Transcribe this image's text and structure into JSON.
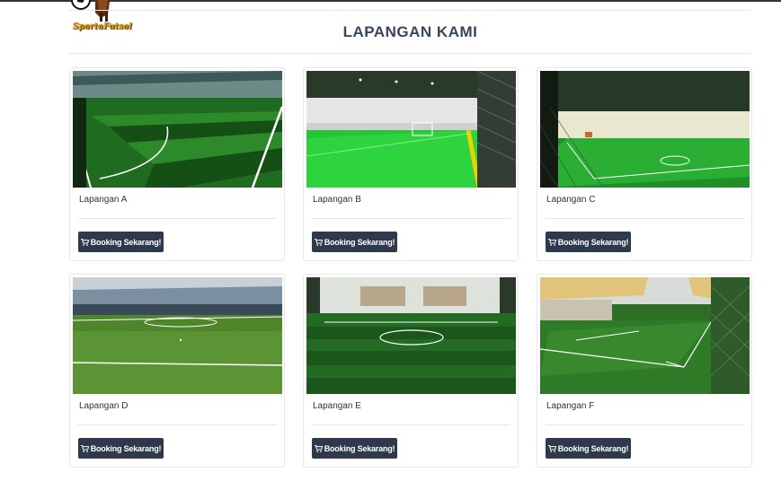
{
  "header": {
    "logo_text": "SpartaFutsal",
    "title": "LAPANGAN KAMI"
  },
  "courts": [
    {
      "name": "Lapangan A",
      "button": "Booking Sekarang!"
    },
    {
      "name": "Lapangan B",
      "button": "Booking Sekarang!"
    },
    {
      "name": "Lapangan C",
      "button": "Booking Sekarang!"
    },
    {
      "name": "Lapangan D",
      "button": "Booking Sekarang!"
    },
    {
      "name": "Lapangan E",
      "button": "Booking Sekarang!"
    },
    {
      "name": "Lapangan F",
      "button": "Booking Sekarang!"
    }
  ],
  "icons": {
    "button_icon": "shopping-cart-icon"
  },
  "colors": {
    "button_bg": "#2e3a4b",
    "title": "#37475a",
    "turf": "#2f7d1e",
    "futsal_floor": "#2dbf3a"
  }
}
